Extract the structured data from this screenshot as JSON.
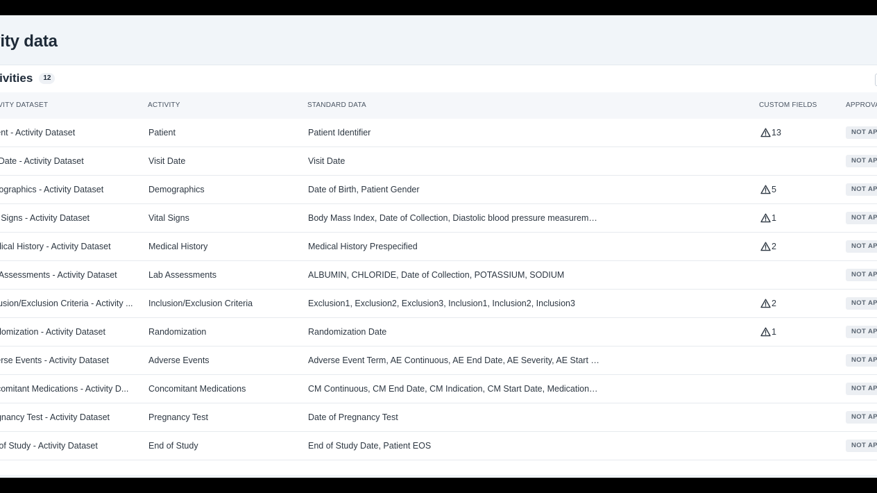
{
  "page": {
    "title": "tivity data"
  },
  "section": {
    "title": "ctivities",
    "count": "12"
  },
  "table": {
    "headers": {
      "dataset": "TIVITY DATASET",
      "activity": "ACTIVITY",
      "standard": "STANDARD DATA",
      "custom": "CUSTOM FIELDS",
      "approval": "APPROVA"
    },
    "rows": [
      {
        "dataset": "tient - Activity Dataset",
        "activity": "Patient",
        "standard": "Patient Identifier",
        "custom": "13",
        "approval": "NOT AP"
      },
      {
        "dataset": "it Date - Activity Dataset",
        "activity": "Visit Date",
        "standard": "Visit Date",
        "custom": "",
        "approval": "NOT AP"
      },
      {
        "dataset": "mographics - Activity Dataset",
        "activity": "Demographics",
        "standard": "Date of Birth, Patient Gender",
        "custom": "5",
        "approval": "NOT AP"
      },
      {
        "dataset": "al Signs - Activity Dataset",
        "activity": "Vital Signs",
        "standard": "Body Mass Index, Date of Collection, Diastolic blood pressure measureme...",
        "custom": "1",
        "approval": "NOT AP"
      },
      {
        "dataset": "edical History - Activity Dataset",
        "activity": "Medical History",
        "standard": "Medical History Prespecified",
        "custom": "2",
        "approval": "NOT AP"
      },
      {
        "dataset": "b Assessments - Activity Dataset",
        "activity": "Lab Assessments",
        "standard": "ALBUMIN, CHLORIDE, Date of Collection, POTASSIUM, SODIUM",
        "custom": "",
        "approval": "NOT AP"
      },
      {
        "dataset": "clusion/Exclusion Criteria - Activity ...",
        "activity": "Inclusion/Exclusion Criteria",
        "standard": "Exclusion1, Exclusion2, Exclusion3, Inclusion1, Inclusion2, Inclusion3",
        "custom": "2",
        "approval": "NOT AP"
      },
      {
        "dataset": "ndomization - Activity Dataset",
        "activity": "Randomization",
        "standard": "Randomization Date",
        "custom": "1",
        "approval": "NOT AP"
      },
      {
        "dataset": "verse Events - Activity Dataset",
        "activity": "Adverse Events",
        "standard": "Adverse Event Term, AE Continuous, AE End Date, AE Severity, AE Start Dat...",
        "custom": "",
        "approval": "NOT AP"
      },
      {
        "dataset": "ncomitant Medications - Activity D...",
        "activity": "Concomitant Medications",
        "standard": "CM Continuous, CM End Date, CM Indication, CM Start Date, Medication N...",
        "custom": "",
        "approval": "NOT AP"
      },
      {
        "dataset": "egnancy Test - Activity Dataset",
        "activity": "Pregnancy Test",
        "standard": "Date of Pregnancy Test",
        "custom": "",
        "approval": "NOT AP"
      },
      {
        "dataset": "d of Study - Activity Dataset",
        "activity": "End of Study",
        "standard": "End of Study Date, Patient EOS",
        "custom": "",
        "approval": "NOT AP"
      }
    ]
  },
  "icons": {
    "custom_field_warning": "warning-triangle-icon"
  },
  "colors": {
    "page_bg": "#f1f5f9",
    "header_bg": "#f5f7fa",
    "badge_bg": "#eceff3",
    "text": "#1e2a38"
  }
}
